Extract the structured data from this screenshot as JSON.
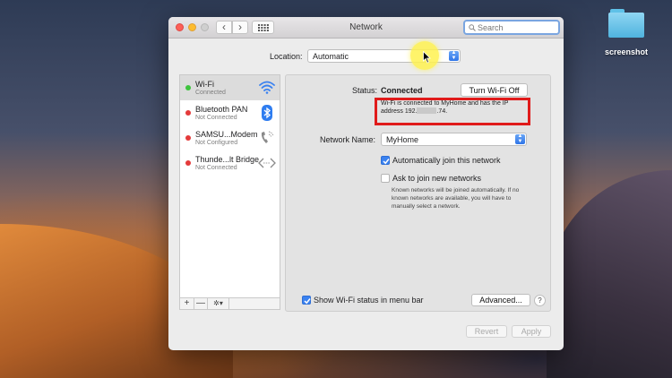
{
  "desktop": {
    "folder_label": "screenshot"
  },
  "window": {
    "title": "Network",
    "search_placeholder": "Search",
    "nav": {
      "back": "‹",
      "forward": "›"
    }
  },
  "location": {
    "label": "Location:",
    "value": "Automatic"
  },
  "services": [
    {
      "name": "Wi-Fi",
      "status": "Connected",
      "state": "green",
      "icon": "wifi-icon",
      "selected": true
    },
    {
      "name": "Bluetooth PAN",
      "status": "Not Connected",
      "state": "red",
      "icon": "bluetooth-icon",
      "selected": false
    },
    {
      "name": "SAMSU...Modem",
      "status": "Not Configured",
      "state": "red",
      "icon": "phone-icon",
      "selected": false
    },
    {
      "name": "Thunde...lt Bridge",
      "status": "Not Connected",
      "state": "red",
      "icon": "thunderbolt-bridge-icon",
      "selected": false
    }
  ],
  "sidebar_footer": {
    "add": "+",
    "remove": "—",
    "action": "✲▾"
  },
  "detail": {
    "status_label": "Status:",
    "status_value": "Connected",
    "turn_off_button": "Turn Wi-Fi Off",
    "status_desc_prefix": "Wi-Fi is connected to MyHome and has the IP address 192.",
    "status_desc_suffix": ".74.",
    "network_name_label": "Network Name:",
    "network_name_value": "MyHome",
    "auto_join_label": "Automatically join this network",
    "auto_join_checked": true,
    "ask_join_label": "Ask to join new networks",
    "ask_join_checked": false,
    "ask_join_note": "Known networks will be joined automatically. If no known networks are available, you will have to manually select a network.",
    "show_status_label": "Show Wi-Fi status in menu bar",
    "show_status_checked": true,
    "advanced_button": "Advanced...",
    "help_button": "?"
  },
  "footer": {
    "revert_button": "Revert",
    "apply_button": "Apply"
  },
  "colors": {
    "accent": "#3b82f0",
    "highlight_box": "#e01b1b",
    "status_green": "#3ec43e",
    "status_red": "#e43a3a"
  }
}
